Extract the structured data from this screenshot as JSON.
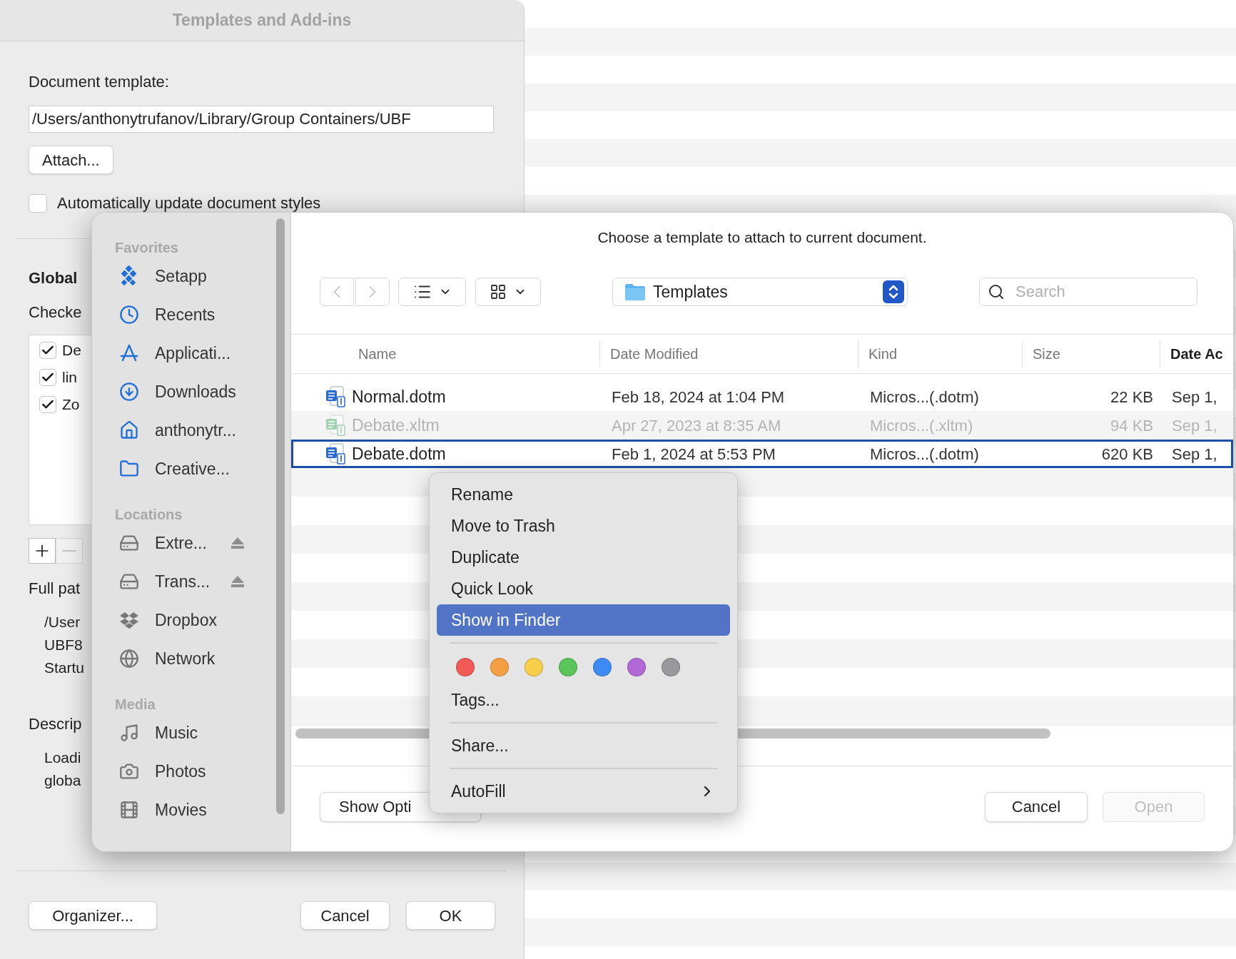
{
  "templates_dialog": {
    "title": "Templates and Add-ins",
    "document_template_label": "Document template:",
    "template_path": "/Users/anthonytrufanov/Library/Group Containers/UBF",
    "attach_button": "Attach...",
    "auto_update": {
      "label": "Automatically update document styles",
      "checked": false
    },
    "global_label": "Global",
    "checked_label": "Checke",
    "global_items": [
      {
        "label": "De",
        "checked": true
      },
      {
        "label": "lin",
        "checked": true
      },
      {
        "label": "Zo",
        "checked": true
      }
    ],
    "full_path_label": "Full pat",
    "full_path_lines": [
      "/User",
      "UBF8",
      "Startu"
    ],
    "description_label": "Descrip",
    "description_lines": [
      "Loadi",
      "globa"
    ],
    "buttons": {
      "organizer": "Organizer...",
      "cancel": "Cancel",
      "ok": "OK"
    }
  },
  "open_dialog": {
    "message": "Choose a template to attach to current document.",
    "location": "Templates",
    "search": {
      "placeholder": "Search"
    },
    "sidebar": [
      {
        "heading": "Favorites",
        "items": [
          {
            "label": "Setapp",
            "ejectable": false
          },
          {
            "label": "Recents",
            "ejectable": false
          },
          {
            "label": "Applicati...",
            "ejectable": false
          },
          {
            "label": "Downloads",
            "ejectable": false
          },
          {
            "label": "anthonytr...",
            "ejectable": false
          },
          {
            "label": "Creative...",
            "ejectable": false
          }
        ]
      },
      {
        "heading": "Locations",
        "items": [
          {
            "label": "Extre...",
            "ejectable": true
          },
          {
            "label": "Trans...",
            "ejectable": true
          },
          {
            "label": "Dropbox",
            "ejectable": false
          },
          {
            "label": "Network",
            "ejectable": false
          }
        ]
      },
      {
        "heading": "Media",
        "items": [
          {
            "label": "Music",
            "ejectable": false
          },
          {
            "label": "Photos",
            "ejectable": false
          },
          {
            "label": "Movies",
            "ejectable": false
          }
        ]
      }
    ],
    "columns": [
      {
        "label": "Name",
        "sorted": false
      },
      {
        "label": "Date Modified",
        "sorted": false
      },
      {
        "label": "Kind",
        "sorted": false
      },
      {
        "label": "Size",
        "sorted": false
      },
      {
        "label": "Date Ac",
        "sorted": true
      }
    ],
    "rows": [
      {
        "kind": "word",
        "name": "Normal.dotm",
        "date_modified": "Feb 18, 2024 at 1:04 PM",
        "file_kind": "Micros...(.dotm)",
        "size": "22 KB",
        "date_added": "Sep 1,",
        "disabled": false,
        "selected": false
      },
      {
        "kind": "excel",
        "name": "Debate.xltm",
        "date_modified": "Apr 27, 2023 at 8:35 AM",
        "file_kind": "Micros...(.xltm)",
        "size": "94 KB",
        "date_added": "Sep 1,",
        "disabled": true,
        "selected": false
      },
      {
        "kind": "word",
        "name": "Debate.dotm",
        "date_modified": "Feb 1, 2024 at 5:53 PM",
        "file_kind": "Micros...(.dotm)",
        "size": "620 KB",
        "date_added": "Sep 1,",
        "disabled": false,
        "selected": true
      }
    ],
    "buttons": {
      "options": "Show Opti",
      "cancel": "Cancel",
      "open": {
        "label": "Open",
        "disabled": true
      }
    }
  },
  "context_menu": {
    "items": [
      {
        "kind": "item",
        "label": "Rename",
        "selected": false
      },
      {
        "kind": "item",
        "label": "Move to Trash",
        "selected": false
      },
      {
        "kind": "item",
        "label": "Duplicate",
        "selected": false
      },
      {
        "kind": "item",
        "label": "Quick Look",
        "selected": false
      },
      {
        "kind": "item",
        "label": "Show in Finder",
        "selected": true
      },
      {
        "kind": "separator"
      },
      {
        "kind": "tags",
        "colors": [
          {
            "color": "#f25a55"
          },
          {
            "color": "#f59f42"
          },
          {
            "color": "#f7cf4a"
          },
          {
            "color": "#5ac65a"
          },
          {
            "color": "#3d8bf2"
          },
          {
            "color": "#b269d6"
          },
          {
            "color": "#98989d"
          }
        ]
      },
      {
        "kind": "item",
        "label": "Tags...",
        "selected": false
      },
      {
        "kind": "separator"
      },
      {
        "kind": "item",
        "label": "Share...",
        "selected": false
      },
      {
        "kind": "separator"
      },
      {
        "kind": "submenu",
        "label": "AutoFill",
        "selected": false
      }
    ]
  }
}
